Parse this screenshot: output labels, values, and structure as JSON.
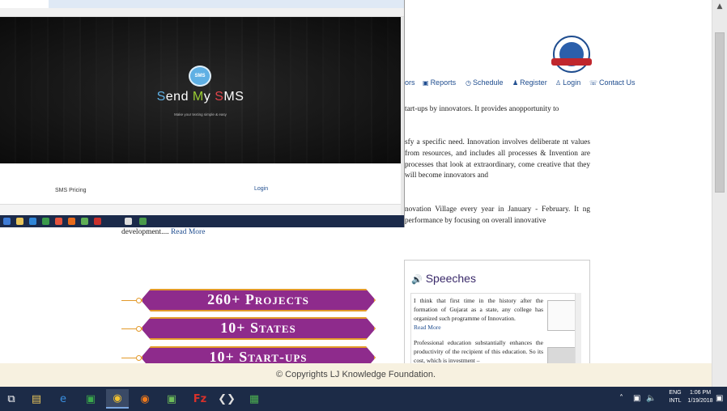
{
  "nav": [
    {
      "label": "ors",
      "icon": ""
    },
    {
      "label": "Reports",
      "icon": "reports-icon"
    },
    {
      "label": "Schedule",
      "icon": "clock-icon"
    },
    {
      "label": "Register",
      "icon": "users-icon"
    },
    {
      "label": "Login",
      "icon": "user-icon"
    },
    {
      "label": "Contact Us",
      "icon": "phone-icon"
    }
  ],
  "paragraphs": {
    "p1": "tart-ups by innovators. It provides anopportunity to",
    "p2": "sfy a specific need. Innovation involves deliberate nt values from resources, and includes all processes & Invention are processes that look at extraordinary, come creative that they will become innovators and",
    "p3": "novation Village every year in January - February. It ng performance by focusing on overall innovative"
  },
  "left_readmore": {
    "text": "development.... ",
    "link": "Read More"
  },
  "stats": [
    "260+ Projects",
    "10+ States",
    "10+ Start-ups"
  ],
  "speeches": {
    "title": "Speeches",
    "items": [
      {
        "text": "I think that first time in the history after the formation of Gujarat as a state, any college has organized such programme of Innovation.",
        "link": "Read More"
      },
      {
        "text": "Professional education substantially enhances the productivity of the recipient of this education. So its cost, which is investment –"
      }
    ]
  },
  "footer": "© Copyrights LJ Knowledge Foundation.",
  "overlay": {
    "sms_badge": "SMS",
    "brand": {
      "a": "S",
      "b": "end ",
      "c": "M",
      "d": "y ",
      "e": "S",
      "f": "MS"
    },
    "tagline": "Make your texting simple & easy",
    "link_pricing": "SMS Pricing",
    "link_login": "Login"
  },
  "taskbar": {
    "lang": "ENG",
    "locale": "INTL",
    "time": "1:06 PM",
    "date": "1/19/2018"
  }
}
